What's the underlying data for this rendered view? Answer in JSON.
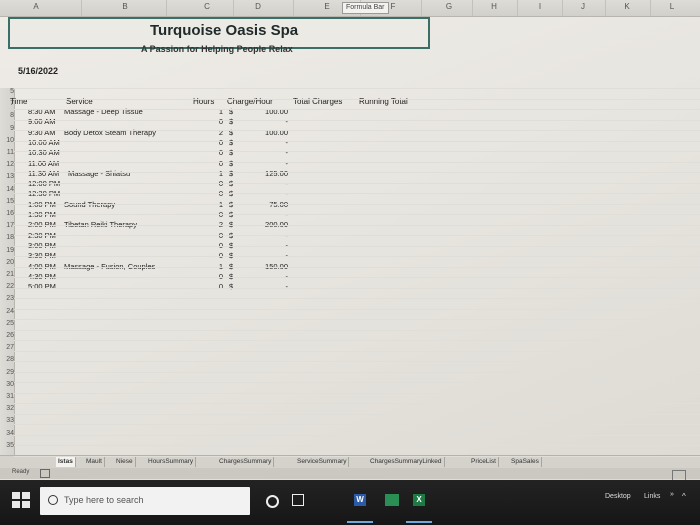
{
  "columns": [
    "A",
    "B",
    "C",
    "D",
    "E",
    "F",
    "G",
    "H",
    "I",
    "J",
    "K",
    "L"
  ],
  "formula_bar_tag": "Formula Bar",
  "sheet": {
    "title": "Turquoise Oasis Spa",
    "tagline": "A Passion for Helping People Relax",
    "date": "5/16/2022",
    "headers": {
      "time": "Time",
      "service": "Service",
      "hours": "Hours",
      "charge_per_hour": "Charge/Hour",
      "total_charges": "Total Charges",
      "running_total": "Running Total"
    },
    "rows": [
      {
        "time": "8:30 AM",
        "service": "Massage - Deep Tissue",
        "hours": "1",
        "currency": "$",
        "charge": "100.00"
      },
      {
        "time": "9:00 AM",
        "service": "",
        "hours": "0",
        "currency": "$",
        "charge": "-"
      },
      {
        "time": "9:30 AM",
        "service": "Body Detox Steam Therapy",
        "hours": "2",
        "currency": "$",
        "charge": "100.00"
      },
      {
        "time": "10:00 AM",
        "service": "",
        "hours": "0",
        "currency": "$",
        "charge": "-"
      },
      {
        "time": "10:30 AM",
        "service": "",
        "hours": "0",
        "currency": "$",
        "charge": "-"
      },
      {
        "time": "11:00 AM",
        "service": "",
        "hours": "0",
        "currency": "$",
        "charge": "-"
      },
      {
        "time": "11:30 AM",
        "service": "Massage - Shiatsu",
        "hours": "1",
        "currency": "$",
        "charge": "125.00"
      },
      {
        "time": "12:00 PM",
        "service": "",
        "hours": "0",
        "currency": "$",
        "charge": "-"
      },
      {
        "time": "12:30 PM",
        "service": "",
        "hours": "0",
        "currency": "$",
        "charge": "-"
      },
      {
        "time": "1:00 PM",
        "service": "Sound Therapy",
        "hours": "1",
        "currency": "$",
        "charge": "75.00"
      },
      {
        "time": "1:30 PM",
        "service": "",
        "hours": "0",
        "currency": "$",
        "charge": "-"
      },
      {
        "time": "2:00 PM",
        "service": "Tibetan Reiki Therapy",
        "hours": "2",
        "currency": "$",
        "charge": "200.00"
      },
      {
        "time": "2:30 PM",
        "service": "",
        "hours": "0",
        "currency": "$",
        "charge": "-"
      },
      {
        "time": "3:00 PM",
        "service": "",
        "hours": "0",
        "currency": "$",
        "charge": "-"
      },
      {
        "time": "3:30 PM",
        "service": "",
        "hours": "0",
        "currency": "$",
        "charge": "-"
      },
      {
        "time": "4:00 PM",
        "service": "Massage - Fusion, Couples",
        "hours": "1",
        "currency": "$",
        "charge": "150.00"
      },
      {
        "time": "4:30 PM",
        "service": "",
        "hours": "0",
        "currency": "$",
        "charge": "-"
      },
      {
        "time": "5:00 PM",
        "service": "",
        "hours": "0",
        "currency": "$",
        "charge": "-"
      }
    ]
  },
  "row_numbers": [
    "5",
    "7",
    "8",
    "9",
    "10",
    "11",
    "12",
    "13",
    "14",
    "15",
    "16",
    "17",
    "18",
    "19",
    "20",
    "21",
    "22",
    "23",
    "24",
    "25",
    "26",
    "27",
    "28",
    "29",
    "30",
    "31",
    "32",
    "33",
    "34",
    "35"
  ],
  "tabs": [
    "Istas",
    "Mault",
    "Niese",
    "HoursSummary",
    "ChargesSummary",
    "ServiceSummary",
    "ChargesSummaryLinked",
    "PriceList",
    "SpaSales"
  ],
  "active_tab": "Istas",
  "status": {
    "ready": "Ready"
  },
  "taskbar": {
    "search_placeholder": "Type here to search",
    "word_letter": "W",
    "excel_letter": "X",
    "desktop_label": "Desktop",
    "links_label": "Links"
  }
}
